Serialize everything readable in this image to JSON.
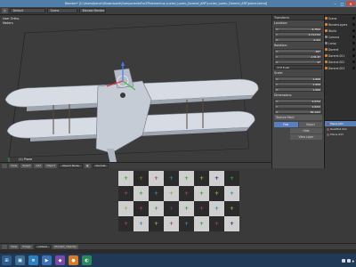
{
  "window": {
    "title": "Blender* [C:\\Users\\bench\\Downloads\\ComponentsForZPelementus-Lucian_Lozeu_Dorerei_ART\\Lucian_Lozeu_Dorerei_ART\\plane.blend]",
    "minimize": "–",
    "maximize": "□",
    "close": "✕"
  },
  "infobar": {
    "menu_icon": "≡",
    "layout": "Default",
    "scene": "Scene",
    "engine": "Blender Render"
  },
  "viewport": {
    "view_label": "User Ortho",
    "units_label": "Meters",
    "object_label": "(1) Plane"
  },
  "n_panel": {
    "header": "Transform",
    "location_label": "Location:",
    "location": [
      {
        "axis": "X:",
        "value": "-4.75m"
      },
      {
        "axis": "Y:",
        "value": "0.7117m"
      },
      {
        "axis": "Z:",
        "value": "2.3m"
      }
    ],
    "rotation_label": "Rotation:",
    "rotation": [
      {
        "axis": "X:",
        "value": "90°"
      },
      {
        "axis": "Y:",
        "value": "-131.6°"
      },
      {
        "axis": "Z:",
        "value": "0°"
      }
    ],
    "rotation_mode": "XYZ Euler",
    "scale_label": "Scale:",
    "scale": [
      {
        "axis": "X:",
        "value": "1.000"
      },
      {
        "axis": "Y:",
        "value": "1.000"
      },
      {
        "axis": "Z:",
        "value": "1.000"
      }
    ],
    "dimensions_label": "Dimensions:",
    "dimensions": [
      {
        "axis": "X:",
        "value": "1.07m"
      },
      {
        "axis": "Y:",
        "value": "1.62m"
      },
      {
        "axis": "Z:",
        "value": "39.12m"
      }
    ],
    "shading_label": "Texture Paint",
    "tab_flat": "Flat",
    "tab_object": "Object",
    "btn_hide": "Hide",
    "btn_view_layer": "View Layer"
  },
  "outliner": {
    "items": [
      {
        "label": "Scene",
        "type": "scene"
      },
      {
        "label": "RenderLayers",
        "type": "scene"
      },
      {
        "label": "World",
        "type": "scene"
      },
      {
        "label": "Camera",
        "type": "cam"
      },
      {
        "label": "Lamp",
        "type": "cam"
      },
      {
        "label": "Dorerei",
        "type": "mesh"
      },
      {
        "label": "Dorerei.001",
        "type": "mesh"
      },
      {
        "label": "Dorerei.002",
        "type": "mesh"
      },
      {
        "label": "Dorerei.003",
        "type": "mesh"
      }
    ]
  },
  "properties": {
    "items": [
      {
        "label": "Plane.001",
        "selected": true
      },
      {
        "label": "RealMat.002",
        "selected": false
      },
      {
        "label": "Plane.003",
        "selected": false
      }
    ]
  },
  "viewport_header": {
    "view": "View",
    "select": "Select",
    "add": "Add",
    "object": "Object",
    "mode": "Object Mode",
    "pivot": "◉",
    "orientation": "Normal"
  },
  "uv_grid": {
    "rows": [
      [
        {
          "m": "+",
          "c": "#3a9a3a"
        },
        {
          "m": "+",
          "c": "#7a7a2a"
        },
        {
          "m": "+",
          "c": "#b24040"
        },
        {
          "m": "+",
          "c": "#2a8ab0"
        },
        {
          "m": "+",
          "c": "#3a9a3a"
        },
        {
          "m": "+",
          "c": "#b0a030"
        },
        {
          "m": "+",
          "c": "#2a2a8a"
        },
        {
          "m": "+",
          "c": "#3a9a3a"
        }
      ],
      [
        {
          "m": "+",
          "c": "#b24040"
        },
        {
          "m": "+",
          "c": "#3a9a3a"
        },
        {
          "m": "+",
          "c": "#2a8ab0"
        },
        {
          "m": "+",
          "c": "#b0a030"
        },
        {
          "m": "+",
          "c": "#b24040"
        },
        {
          "m": "+",
          "c": "#3a9a3a"
        },
        {
          "m": "+",
          "c": "#b0a030"
        },
        {
          "m": "+",
          "c": "#2a8ab0"
        }
      ],
      [
        {
          "m": "+",
          "c": "#b0a030"
        },
        {
          "m": "+",
          "c": "#b24040"
        },
        {
          "m": "+",
          "c": "#3a9a3a"
        },
        {
          "m": "+",
          "c": "#7a2a8a"
        },
        {
          "m": "+",
          "c": "#3a9a3a"
        },
        {
          "m": "+",
          "c": "#b24040"
        },
        {
          "m": "+",
          "c": "#2a8ab0"
        },
        {
          "m": "+",
          "c": "#b0a030"
        }
      ],
      [
        {
          "m": "+",
          "c": "#b24040"
        },
        {
          "m": "+",
          "c": "#2a8ab0"
        },
        {
          "m": "+",
          "c": "#b0a030"
        },
        {
          "m": "+",
          "c": "#b24040"
        },
        {
          "m": "+",
          "c": "#2a8ab0"
        },
        {
          "m": "+",
          "c": "#3a9a3a"
        },
        {
          "m": "+",
          "c": "#b24040"
        },
        {
          "m": "+",
          "c": "#2a2a8a"
        }
      ]
    ]
  },
  "uv_header": {
    "view": "View",
    "image": "Image",
    "image_name": "UVGrid",
    "status": "Shaded_objectly"
  },
  "taskbar": {
    "apps": [
      {
        "icon": "⊞",
        "color": "#2c5d8f"
      },
      {
        "icon": "▣",
        "color": "#3c6e9c"
      },
      {
        "icon": "≣",
        "color": "#2e7fbf"
      },
      {
        "icon": "▶",
        "color": "#3b73b8"
      },
      {
        "icon": "◆",
        "color": "#7a4aa8"
      },
      {
        "icon": "●",
        "color": "#d97a1e"
      },
      {
        "icon": "◐",
        "color": "#2a8a5a"
      }
    ],
    "tray_text": "▲"
  }
}
